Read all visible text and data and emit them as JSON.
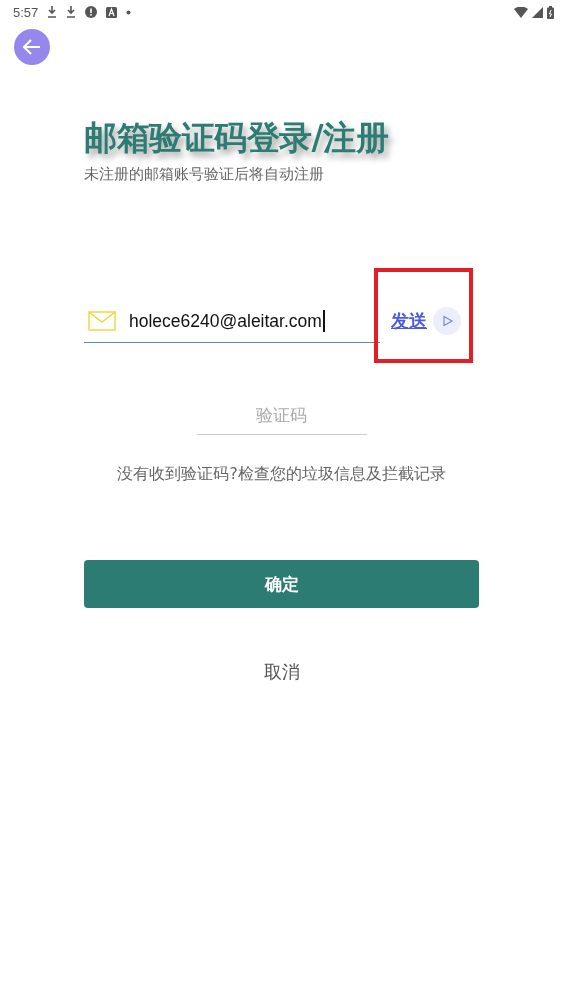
{
  "status_bar": {
    "time": "5:57"
  },
  "title": "邮箱验证码登录/注册",
  "subtitle": "未注册的邮箱账号验证后将自动注册",
  "email_field": {
    "value": "holece6240@aleitar.com",
    "focused": true
  },
  "send_link": "发送",
  "code_field": {
    "placeholder": "验证码"
  },
  "hint": "没有收到验证码?检查您的垃圾信息及拦截记录",
  "confirm_button": "确定",
  "cancel_button": "取消"
}
